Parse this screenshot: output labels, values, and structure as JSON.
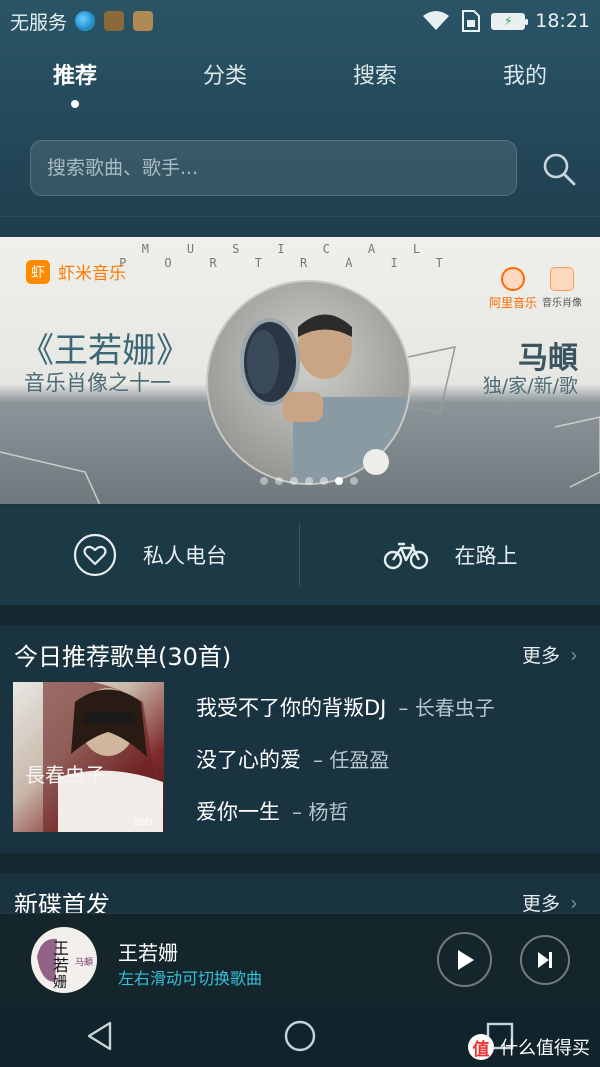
{
  "status_bar": {
    "carrier": "无服务",
    "time": "18:21",
    "icons": [
      "globe-app-icon",
      "game-app-icon",
      "gallery-app-icon",
      "wifi-icon",
      "sim-icon",
      "battery-charging-icon"
    ]
  },
  "tabs": [
    {
      "label": "推荐",
      "active": true
    },
    {
      "label": "分类",
      "active": false
    },
    {
      "label": "搜索",
      "active": false
    },
    {
      "label": "我的",
      "active": false
    }
  ],
  "search": {
    "placeholder": "搜索歌曲、歌手..."
  },
  "banner": {
    "strip_text": "MUSICAL PORTRAIT",
    "brand": "虾米音乐",
    "brand_badge": "虾",
    "title": "《王若姗》",
    "subtitle": "音乐肖像之十一",
    "artist": "马頔",
    "tagline": "独/家/新/歌",
    "partner_1": "阿里音乐",
    "partner_2": "音乐肖像",
    "page_count": 7,
    "current_page": 6
  },
  "quick_actions": [
    {
      "label": "私人电台",
      "icon": "heart-icon"
    },
    {
      "label": "在路上",
      "icon": "bicycle-icon"
    }
  ],
  "recommended": {
    "title": "今日推荐歌单(30首)",
    "more": "更多",
    "cover_text": "長春虫子",
    "songs": [
      {
        "name": "我受不了你的背叛DJ",
        "artist": "– 长春虫子"
      },
      {
        "name": "没了心的爱",
        "artist": "– 任盈盈"
      },
      {
        "name": "爱你一生",
        "artist": "– 杨哲"
      }
    ]
  },
  "new_releases": {
    "title": "新碟首发",
    "more": "更多"
  },
  "player": {
    "track": "王若姗",
    "hint": "左右滑动可切换歌曲",
    "cover_text": "王若姗"
  },
  "watermark": {
    "badge": "值",
    "text": "什么值得买"
  },
  "colors": {
    "accent_cyan": "#35c0d8",
    "brand_orange": "#ff7a00",
    "background": "#1a3440"
  }
}
